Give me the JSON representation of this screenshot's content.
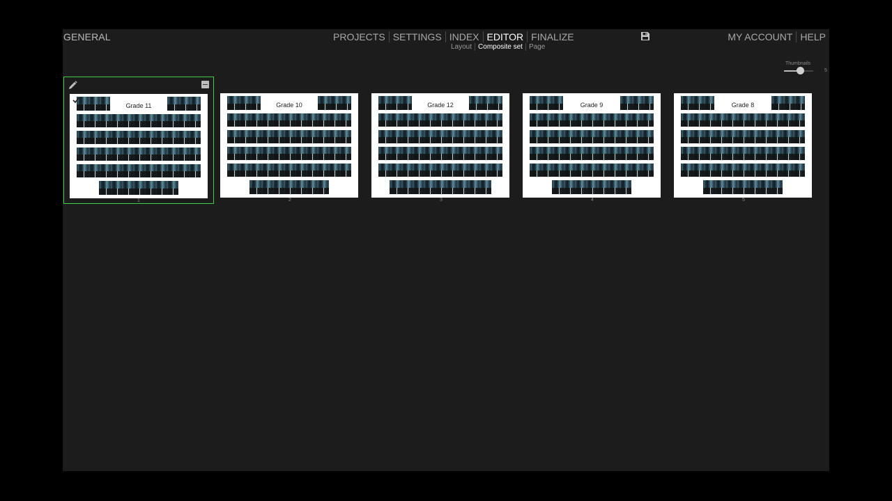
{
  "header": {
    "left_title": "GENERAL",
    "main_nav": [
      {
        "label": "PROJECTS",
        "active": false
      },
      {
        "label": "SETTINGS",
        "active": false
      },
      {
        "label": "INDEX",
        "active": false
      },
      {
        "label": "EDITOR",
        "active": true
      },
      {
        "label": "FINALIZE",
        "active": false
      }
    ],
    "sub_nav": [
      {
        "label": "Layout",
        "active": false
      },
      {
        "label": "Composite set",
        "active": true
      },
      {
        "label": "Page",
        "active": false
      }
    ],
    "save_icon": "floppy-disk-icon",
    "right_nav": [
      {
        "label": "MY ACCOUNT"
      },
      {
        "label": "HELP"
      }
    ]
  },
  "thumbnail_slider": {
    "label": "Thumbnails",
    "value_label": "5",
    "fraction": 0.55
  },
  "pages": [
    {
      "title": "Grade 11",
      "number": "1",
      "selected": true
    },
    {
      "title": "Grade 10",
      "number": "2",
      "selected": false
    },
    {
      "title": "Grade 12",
      "number": "3",
      "selected": false
    },
    {
      "title": "Grade 9",
      "number": "4",
      "selected": false
    },
    {
      "title": "Grade 8",
      "number": "5",
      "selected": false
    }
  ],
  "colors": {
    "background": "#1c1c1c",
    "selection": "#3fd13f",
    "active_text": "#ffffff",
    "inactive_text": "#a9a9a9"
  }
}
